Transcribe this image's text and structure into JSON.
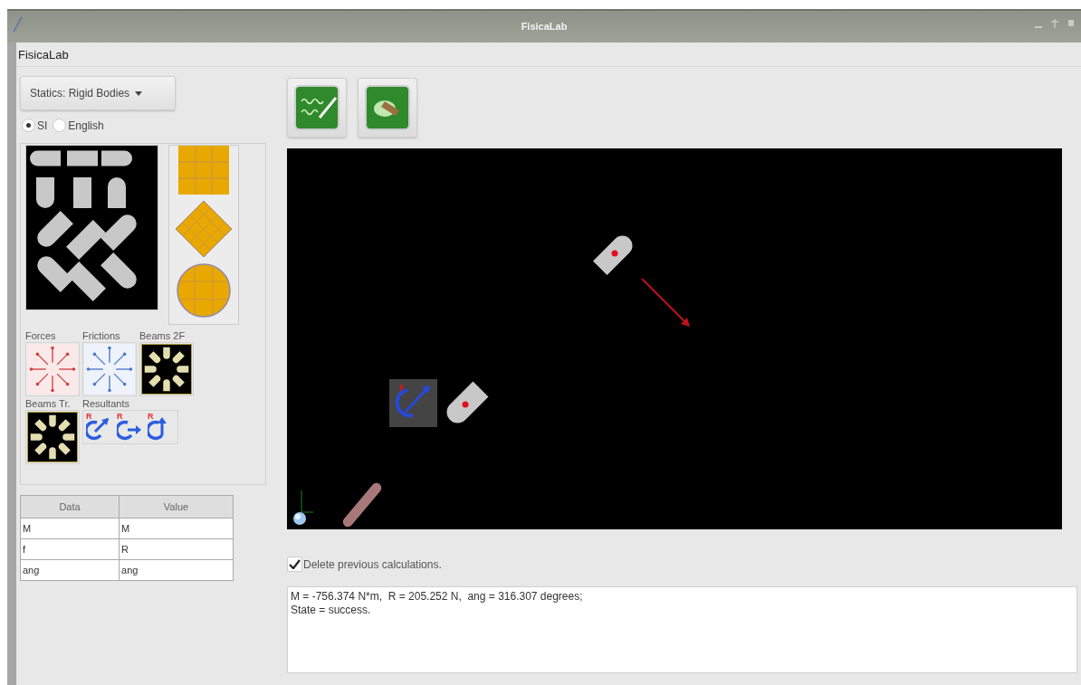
{
  "window": {
    "title": "FisicaLab"
  },
  "menu": [
    "FisicaLab"
  ],
  "module_selector": {
    "value": "Statics: Rigid Bodies"
  },
  "units": [
    {
      "label": "SI",
      "selected": true
    },
    {
      "label": "English",
      "selected": false
    }
  ],
  "palette_groups": [
    {
      "label": "Forces",
      "kind": "forces"
    },
    {
      "label": "Frictions",
      "kind": "frictions"
    },
    {
      "label": "Beams 2F",
      "kind": "beams"
    },
    {
      "label": "Beams Tr.",
      "kind": "beams"
    },
    {
      "label": "Resultants",
      "kind": "resultants",
      "marks": [
        "R",
        "R",
        "R"
      ]
    }
  ],
  "table": {
    "columns": [
      "Data",
      "Value"
    ],
    "rows": [
      [
        "M",
        "M"
      ],
      [
        "f",
        "R"
      ],
      [
        "ang",
        "ang"
      ]
    ]
  },
  "delete_previous": {
    "label": "Delete previous calculations.",
    "checked": true
  },
  "output": {
    "lines": [
      "M = -756.374 N*m,  R = 205.252 N,  ang = 316.307 degrees;",
      "State = success."
    ]
  }
}
